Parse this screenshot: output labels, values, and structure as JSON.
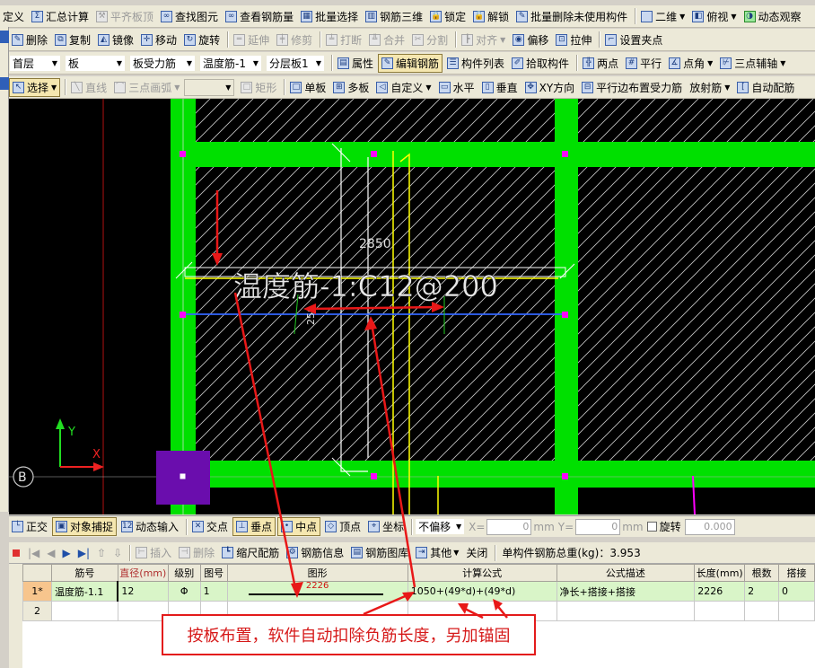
{
  "toolbar1": {
    "items": [
      "定义",
      "汇总计算",
      "平齐板顶",
      "查找图元",
      "查看钢筋量",
      "批量选择",
      "钢筋三维",
      "锁定",
      "解锁",
      "批量删除未使用构件",
      "二维",
      "俯视",
      "动态观察"
    ]
  },
  "toolbar2": {
    "items": [
      "删除",
      "复制",
      "镜像",
      "移动",
      "旋转",
      "延伸",
      "修剪",
      "打断",
      "合并",
      "分割",
      "对齐",
      "偏移",
      "拉伸",
      "设置夹点"
    ]
  },
  "toolbar3": {
    "floor": "首层",
    "category": "板",
    "subtype": "板受力筋",
    "component": "温度筋-1",
    "layer": "分层板1",
    "items": [
      "属性",
      "编辑钢筋",
      "构件列表",
      "拾取构件",
      "两点",
      "平行",
      "点角",
      "三点辅轴"
    ]
  },
  "toolbar4": {
    "items": [
      "选择",
      "直线",
      "三点画弧",
      "矩形",
      "单板",
      "多板",
      "自定义",
      "水平",
      "垂直",
      "XY方向",
      "平行边布置受力筋",
      "放射筋",
      "自动配筋"
    ]
  },
  "canvas": {
    "dimension_text": "2850",
    "rebar_label": "温度筋-1:C12@200",
    "axis_y": "Y",
    "axis_x": "X",
    "grid_label": "B",
    "small_dim": "250",
    "colors": {
      "beam": "#00e000",
      "slab_hatch": "#ffffff",
      "rebar_blue": "#3366ff",
      "rebar_yellow": "#ffff00",
      "red": "#ff2020",
      "magenta": "#ff00ff",
      "purple": "#6a0dad"
    }
  },
  "snapbar": {
    "items": [
      "正交",
      "对象捕捉",
      "动态输入",
      "交点",
      "垂点",
      "中点",
      "顶点",
      "坐标"
    ],
    "offset_mode": "不偏移",
    "x_label": "X=",
    "x_value": "0",
    "y_label": "Y=",
    "y_value": "0",
    "unit": "mm",
    "rotate_label": "旋转",
    "rotate_value": "0.000"
  },
  "rebarbar": {
    "items": [
      "插入",
      "删除",
      "缩尺配筋",
      "钢筋信息",
      "钢筋图库",
      "其他",
      "关闭"
    ],
    "total_weight": "单构件钢筋总重(kg)：3.953"
  },
  "table": {
    "headers": [
      "",
      "筋号",
      "直径(mm)",
      "级别",
      "图号",
      "图形",
      "计算公式",
      "公式描述",
      "长度(mm)",
      "根数",
      "搭接"
    ],
    "rows": [
      {
        "num": "1*",
        "name": "温度筋-1.1",
        "diameter": "12",
        "grade": "Φ",
        "fig": "1",
        "shape_value": "2226",
        "formula": "1050+(49*d)+(49*d)",
        "desc": "净长+搭接+搭接",
        "length": "2226",
        "count": "2",
        "lap": "0"
      },
      {
        "num": "2",
        "name": "",
        "diameter": "",
        "grade": "",
        "fig": "",
        "shape_value": "",
        "formula": "",
        "desc": "",
        "length": "",
        "count": "",
        "lap": ""
      }
    ]
  },
  "annotation": {
    "text": "按板布置，软件自动扣除负筋长度，另加锚固"
  }
}
